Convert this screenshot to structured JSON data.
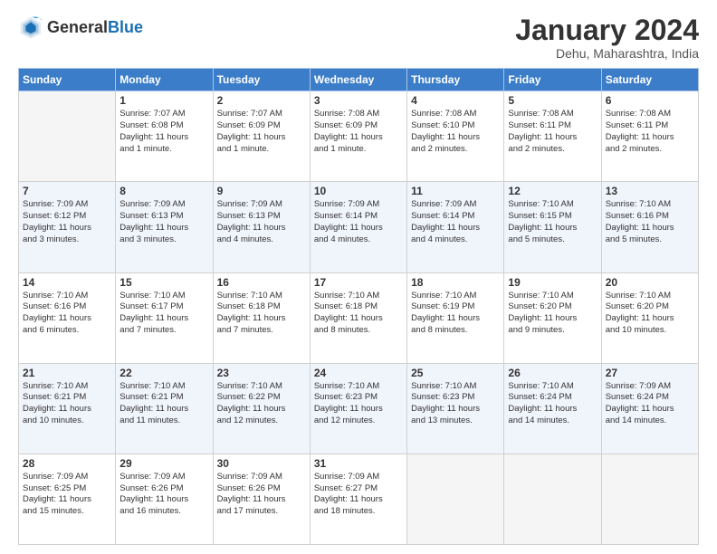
{
  "header": {
    "logo_general": "General",
    "logo_blue": "Blue",
    "title": "January 2024",
    "subtitle": "Dehu, Maharashtra, India"
  },
  "days_of_week": [
    "Sunday",
    "Monday",
    "Tuesday",
    "Wednesday",
    "Thursday",
    "Friday",
    "Saturday"
  ],
  "weeks": [
    [
      {
        "day": "",
        "info": ""
      },
      {
        "day": "1",
        "info": "Sunrise: 7:07 AM\nSunset: 6:08 PM\nDaylight: 11 hours\nand 1 minute."
      },
      {
        "day": "2",
        "info": "Sunrise: 7:07 AM\nSunset: 6:09 PM\nDaylight: 11 hours\nand 1 minute."
      },
      {
        "day": "3",
        "info": "Sunrise: 7:08 AM\nSunset: 6:09 PM\nDaylight: 11 hours\nand 1 minute."
      },
      {
        "day": "4",
        "info": "Sunrise: 7:08 AM\nSunset: 6:10 PM\nDaylight: 11 hours\nand 2 minutes."
      },
      {
        "day": "5",
        "info": "Sunrise: 7:08 AM\nSunset: 6:11 PM\nDaylight: 11 hours\nand 2 minutes."
      },
      {
        "day": "6",
        "info": "Sunrise: 7:08 AM\nSunset: 6:11 PM\nDaylight: 11 hours\nand 2 minutes."
      }
    ],
    [
      {
        "day": "7",
        "info": "Sunrise: 7:09 AM\nSunset: 6:12 PM\nDaylight: 11 hours\nand 3 minutes."
      },
      {
        "day": "8",
        "info": "Sunrise: 7:09 AM\nSunset: 6:13 PM\nDaylight: 11 hours\nand 3 minutes."
      },
      {
        "day": "9",
        "info": "Sunrise: 7:09 AM\nSunset: 6:13 PM\nDaylight: 11 hours\nand 4 minutes."
      },
      {
        "day": "10",
        "info": "Sunrise: 7:09 AM\nSunset: 6:14 PM\nDaylight: 11 hours\nand 4 minutes."
      },
      {
        "day": "11",
        "info": "Sunrise: 7:09 AM\nSunset: 6:14 PM\nDaylight: 11 hours\nand 4 minutes."
      },
      {
        "day": "12",
        "info": "Sunrise: 7:10 AM\nSunset: 6:15 PM\nDaylight: 11 hours\nand 5 minutes."
      },
      {
        "day": "13",
        "info": "Sunrise: 7:10 AM\nSunset: 6:16 PM\nDaylight: 11 hours\nand 5 minutes."
      }
    ],
    [
      {
        "day": "14",
        "info": "Sunrise: 7:10 AM\nSunset: 6:16 PM\nDaylight: 11 hours\nand 6 minutes."
      },
      {
        "day": "15",
        "info": "Sunrise: 7:10 AM\nSunset: 6:17 PM\nDaylight: 11 hours\nand 7 minutes."
      },
      {
        "day": "16",
        "info": "Sunrise: 7:10 AM\nSunset: 6:18 PM\nDaylight: 11 hours\nand 7 minutes."
      },
      {
        "day": "17",
        "info": "Sunrise: 7:10 AM\nSunset: 6:18 PM\nDaylight: 11 hours\nand 8 minutes."
      },
      {
        "day": "18",
        "info": "Sunrise: 7:10 AM\nSunset: 6:19 PM\nDaylight: 11 hours\nand 8 minutes."
      },
      {
        "day": "19",
        "info": "Sunrise: 7:10 AM\nSunset: 6:20 PM\nDaylight: 11 hours\nand 9 minutes."
      },
      {
        "day": "20",
        "info": "Sunrise: 7:10 AM\nSunset: 6:20 PM\nDaylight: 11 hours\nand 10 minutes."
      }
    ],
    [
      {
        "day": "21",
        "info": "Sunrise: 7:10 AM\nSunset: 6:21 PM\nDaylight: 11 hours\nand 10 minutes."
      },
      {
        "day": "22",
        "info": "Sunrise: 7:10 AM\nSunset: 6:21 PM\nDaylight: 11 hours\nand 11 minutes."
      },
      {
        "day": "23",
        "info": "Sunrise: 7:10 AM\nSunset: 6:22 PM\nDaylight: 11 hours\nand 12 minutes."
      },
      {
        "day": "24",
        "info": "Sunrise: 7:10 AM\nSunset: 6:23 PM\nDaylight: 11 hours\nand 12 minutes."
      },
      {
        "day": "25",
        "info": "Sunrise: 7:10 AM\nSunset: 6:23 PM\nDaylight: 11 hours\nand 13 minutes."
      },
      {
        "day": "26",
        "info": "Sunrise: 7:10 AM\nSunset: 6:24 PM\nDaylight: 11 hours\nand 14 minutes."
      },
      {
        "day": "27",
        "info": "Sunrise: 7:09 AM\nSunset: 6:24 PM\nDaylight: 11 hours\nand 14 minutes."
      }
    ],
    [
      {
        "day": "28",
        "info": "Sunrise: 7:09 AM\nSunset: 6:25 PM\nDaylight: 11 hours\nand 15 minutes."
      },
      {
        "day": "29",
        "info": "Sunrise: 7:09 AM\nSunset: 6:26 PM\nDaylight: 11 hours\nand 16 minutes."
      },
      {
        "day": "30",
        "info": "Sunrise: 7:09 AM\nSunset: 6:26 PM\nDaylight: 11 hours\nand 17 minutes."
      },
      {
        "day": "31",
        "info": "Sunrise: 7:09 AM\nSunset: 6:27 PM\nDaylight: 11 hours\nand 18 minutes."
      },
      {
        "day": "",
        "info": ""
      },
      {
        "day": "",
        "info": ""
      },
      {
        "day": "",
        "info": ""
      }
    ]
  ]
}
